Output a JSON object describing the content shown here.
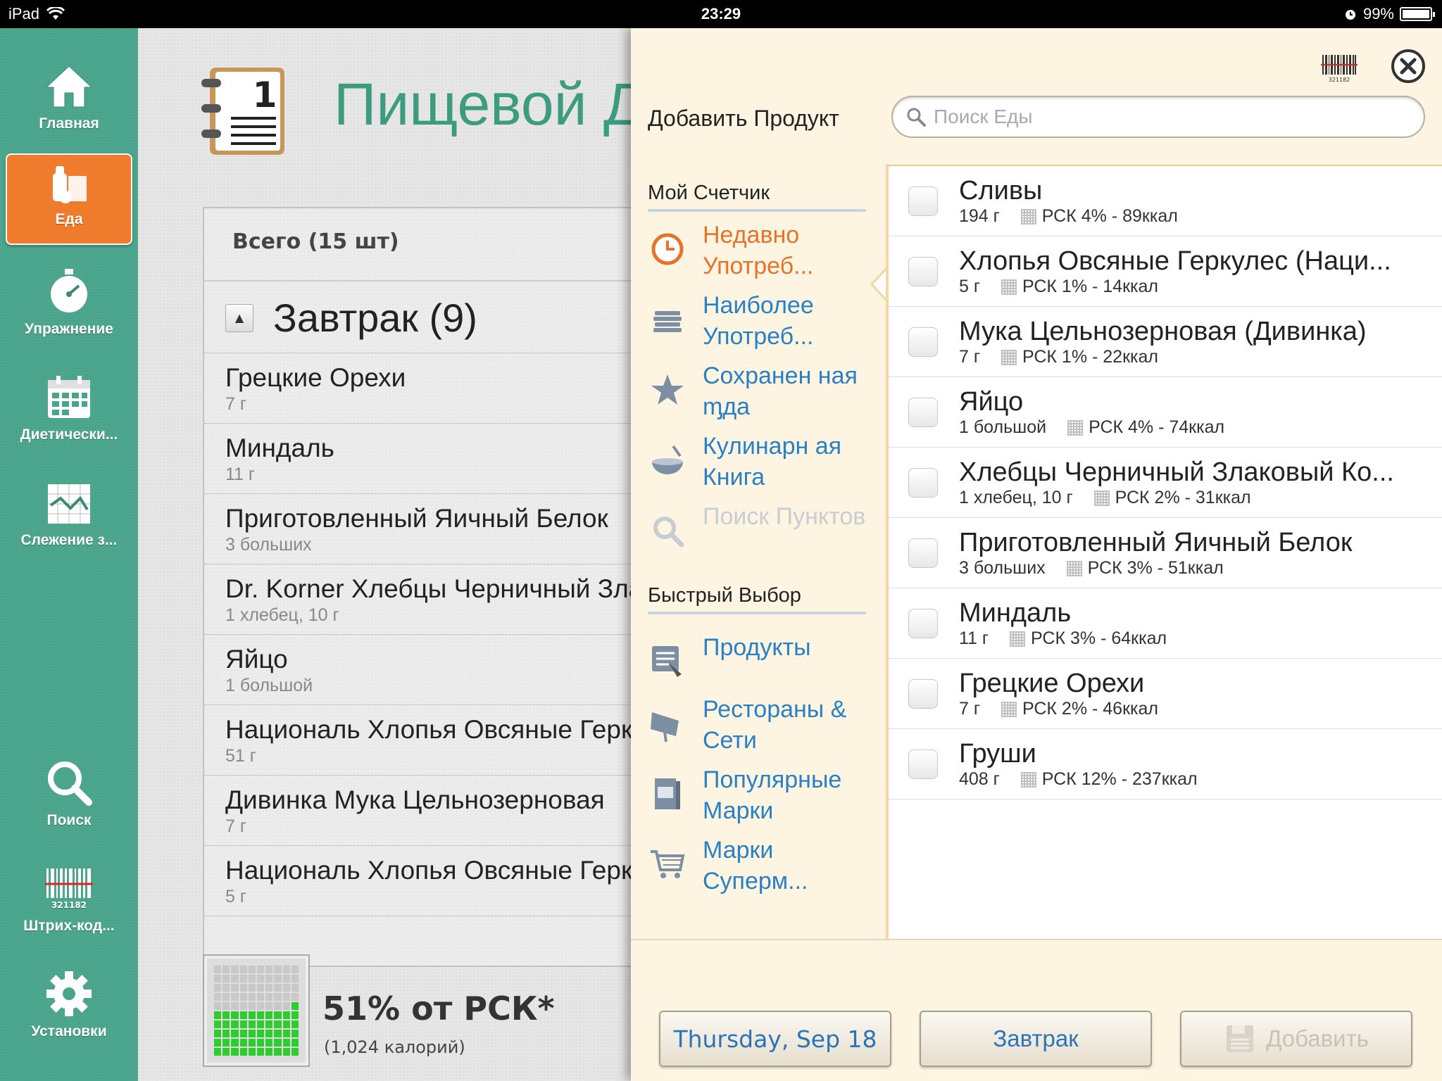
{
  "status_bar": {
    "device": "iPad",
    "time": "23:29",
    "battery": "99%",
    "battery_level": 0.99
  },
  "sidebar": {
    "items": [
      {
        "label": "Главная",
        "icon": "home-icon"
      },
      {
        "label": "Еда",
        "icon": "food-icon",
        "active": true
      },
      {
        "label": "Упражнение",
        "icon": "stopwatch-icon"
      },
      {
        "label": "Диетически...",
        "icon": "calendar-icon"
      },
      {
        "label": "Слежение з...",
        "icon": "chart-icon"
      },
      {
        "label": "Поиск",
        "icon": "search-icon"
      },
      {
        "label": "Штрих-код...",
        "icon": "barcode-icon"
      },
      {
        "label": "Установки",
        "icon": "gear-icon"
      }
    ]
  },
  "main": {
    "title": "Пищевой Д",
    "diary_icon_number": "1",
    "total_label": "Всего (15 шт)",
    "section": {
      "title": "Завтрак (9)",
      "collapse_symbol": "▲"
    },
    "foods": [
      {
        "name": "Грецкие Орехи",
        "serving": "7 г"
      },
      {
        "name": "Миндаль",
        "serving": "11 г"
      },
      {
        "name": "Приготовленный Яичный Белок",
        "serving": "3 больших"
      },
      {
        "name": "Dr. Korner Хлебцы Черничный Злаковый",
        "serving": "1 хлебец, 10 г"
      },
      {
        "name": "Яйцо",
        "serving": "1 большой"
      },
      {
        "name": "Националь Хлопья Овсяные Геркулес",
        "serving": "51 г"
      },
      {
        "name": "Дивинка Мука Цельнозерновая",
        "serving": "7 г"
      },
      {
        "name": "Националь Хлопья Овсяные Геркулес",
        "serving": "5 г"
      }
    ],
    "rdi": {
      "percent_text": "51% от РСК*",
      "calories_text": "(1,024 калорий)",
      "fill_fraction": 0.51
    }
  },
  "panel": {
    "title": "Добавить Продукт",
    "search": {
      "placeholder": "Поиск Еды",
      "value": ""
    },
    "barcode_digits": "321182",
    "my_counter": {
      "header": "Мой Счетчик",
      "items": [
        {
          "label": "Недавно Употреб...",
          "icon": "clock-icon",
          "state": "active"
        },
        {
          "label": "Наиболее Употреб...",
          "icon": "stack-icon",
          "state": "normal"
        },
        {
          "label": "Сохранен ная ᶆда",
          "icon": "star-icon",
          "state": "normal"
        },
        {
          "label": "Кулинарн ая Книга",
          "icon": "mixing-bowl-icon",
          "state": "normal"
        },
        {
          "label": "Поиск Пунктов",
          "icon": "search-icon",
          "state": "disabled"
        }
      ]
    },
    "quick_pick": {
      "header": "Быстрый Выбор",
      "items": [
        {
          "label": "Продукты",
          "icon": "food-list-icon"
        },
        {
          "label": "Рестораны & Сети",
          "icon": "restaurant-icon"
        },
        {
          "label": "Популярные Марки",
          "icon": "cereal-box-icon"
        },
        {
          "label": "Марки Суперм...",
          "icon": "shopping-cart-icon"
        }
      ]
    },
    "results": [
      {
        "name": "Сливы",
        "serving": "194 г",
        "rdi": "РСК 4% - 89ккал"
      },
      {
        "name": "Хлопья Овсяные Геркулес (Наци...",
        "serving": "5 г",
        "rdi": "РСК 1% - 14ккал"
      },
      {
        "name": "Мука Цельнозерновая (Дивинка)",
        "serving": "7 г",
        "rdi": "РСК 1% - 22ккал"
      },
      {
        "name": "Яйцо",
        "serving": "1 большой",
        "rdi": "РСК 4% - 74ккал"
      },
      {
        "name": "Хлебцы Черничный Злаковый Ко...",
        "serving": "1 хлебец, 10 г",
        "rdi": "РСК 2% - 31ккал"
      },
      {
        "name": "Приготовленный Яичный Белок",
        "serving": "3 больших",
        "rdi": "РСК 3% - 51ккал"
      },
      {
        "name": "Миндаль",
        "serving": "11 г",
        "rdi": "РСК 3% - 64ккал"
      },
      {
        "name": "Грецкие Орехи",
        "serving": "7 г",
        "rdi": "РСК 2% - 46ккал"
      },
      {
        "name": "Груши",
        "serving": "408 г",
        "rdi": "РСК 12% - 237ккал"
      }
    ],
    "footer": {
      "date_button": "Thursday, Sep 18",
      "meal_button": "Завтрак",
      "add_button": "Добавить"
    }
  },
  "colors": {
    "sidebar": "#4aa48c",
    "sidebar_active": "#ef7b2d",
    "title_green": "#3d9c7f",
    "link_blue": "#2980c4",
    "active_orange": "#e5742a",
    "panel_bg": "#fdf5e2"
  }
}
